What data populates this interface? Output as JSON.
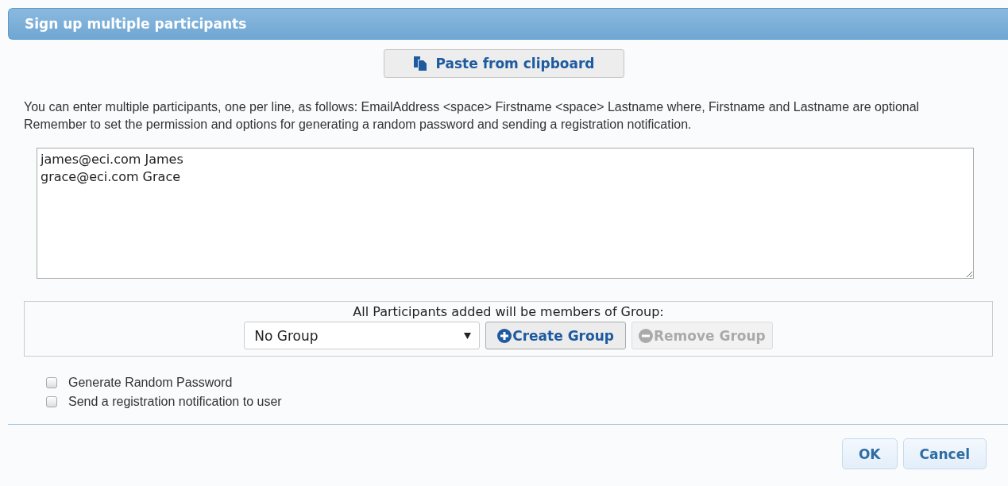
{
  "dialog": {
    "title": "Sign up multiple participants"
  },
  "paste_button": {
    "label": "Paste from clipboard"
  },
  "instructions": "You can enter multiple participants, one per line, as follows: EmailAddress <space> Firstname <space> Lastname where, Firstname and Lastname are optional Remember to set the permission and options for generating a random password and sending a registration notification.",
  "participants_field": {
    "lines": [
      "james@eci.com James",
      "grace@eci.com Grace"
    ]
  },
  "group_panel": {
    "caption": "All Participants added will be members of Group:",
    "group_select": {
      "value": "No Group"
    },
    "buttons": [
      {
        "kind": "create",
        "label": "Create Group",
        "disabled": false
      },
      {
        "kind": "remove",
        "label": "Remove Group",
        "disabled": true
      }
    ]
  },
  "options": [
    {
      "label": "Generate Random Password",
      "checked": false
    },
    {
      "label": "Send a registration notification to user",
      "checked": false
    }
  ],
  "footer_buttons": [
    "OK",
    "Cancel"
  ]
}
